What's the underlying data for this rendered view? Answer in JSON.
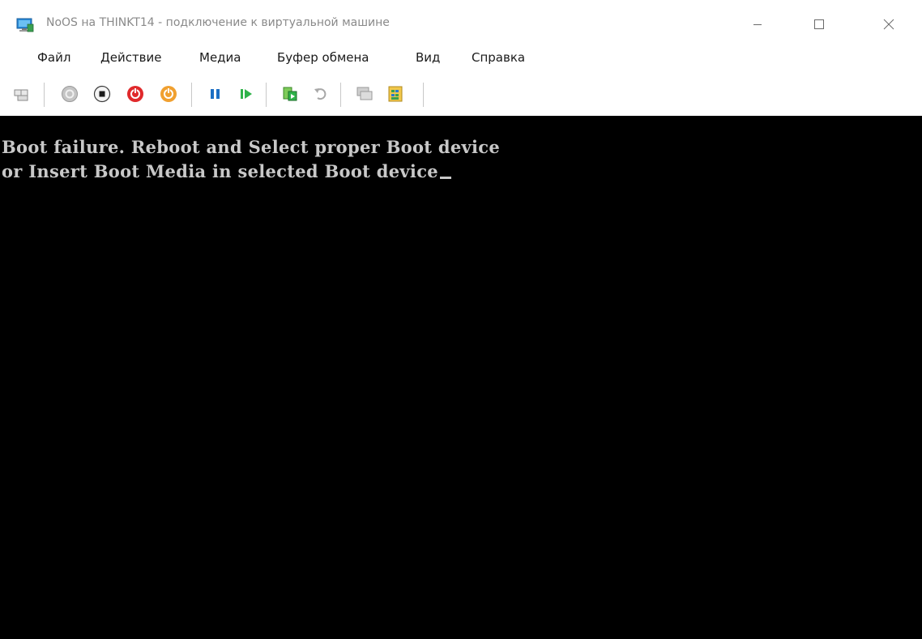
{
  "window": {
    "title": "NoOS на THINKT14 - подключение к виртуальной машине"
  },
  "menu": {
    "file": "Файл",
    "action": "Действие",
    "media": "Медиа",
    "clipboard": "Буфер обмена",
    "view": "Вид",
    "help": "Справка"
  },
  "toolbar": {
    "icons": [
      "ctrl-alt-del-icon",
      "start-icon",
      "turn-off-icon",
      "shutdown-icon",
      "save-icon",
      "pause-icon",
      "resume-icon",
      "checkpoint-icon",
      "revert-icon",
      "enhanced-session-icon",
      "share-icon"
    ]
  },
  "console": {
    "line1": "Boot failure. Reboot and Select proper Boot device",
    "line2": "or Insert Boot Media in selected Boot device"
  },
  "colors": {
    "console_bg": "#000000",
    "console_text": "#c8c8c8",
    "title_text": "#8a8a8a",
    "turn_off_red": "#e0292b",
    "save_orange": "#f0a030",
    "pause_blue": "#1c6fc4",
    "resume_green": "#2fb34a"
  }
}
